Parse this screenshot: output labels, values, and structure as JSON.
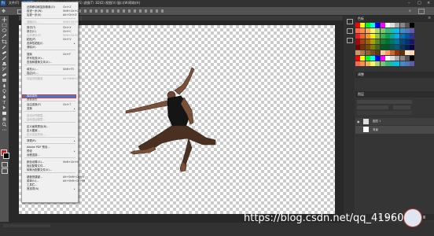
{
  "menubar": {
    "items": [
      "文件(F)",
      "编辑(E)",
      "图像(I)",
      "图层(L)",
      "文字(Y)",
      "选择(S)",
      "滤镜(T)",
      "3D(D)",
      "视图(V)",
      "窗口(W)",
      "帮助(H)"
    ]
  },
  "edit_menu": {
    "items": [
      {
        "label": "还原移动和复制像素(O)",
        "shortcut": "Ctrl+Z",
        "enabled": true
      },
      {
        "label": "前进一步(W)",
        "shortcut": "Shift+Ctrl+Z",
        "enabled": true
      },
      {
        "label": "后退一步(K)",
        "shortcut": "Alt+Ctrl+Z",
        "enabled": true
      },
      {
        "label": "渐隐(D)...",
        "shortcut": "Shift+Ctrl+F",
        "enabled": false
      },
      {
        "label": "剪切(T)",
        "shortcut": "Ctrl+X",
        "enabled": true
      },
      {
        "label": "拷贝(C)",
        "shortcut": "Ctrl+C",
        "enabled": true
      },
      {
        "label": "合并拷贝(Y)",
        "shortcut": "Shift+Ctrl+C",
        "enabled": false
      },
      {
        "label": "粘贴(P)",
        "shortcut": "Ctrl+V",
        "enabled": true
      },
      {
        "label": "选择性粘贴(I)",
        "shortcut": "",
        "enabled": true,
        "submenu": true
      },
      {
        "label": "清除(E)",
        "shortcut": "",
        "enabled": true
      },
      {
        "label": "搜索",
        "shortcut": "Ctrl+F",
        "enabled": true
      },
      {
        "label": "拼写检查(H)...",
        "shortcut": "",
        "enabled": true
      },
      {
        "label": "查找和替换文本(X)...",
        "shortcut": "",
        "enabled": true
      },
      {
        "label": "填充(L)...",
        "shortcut": "Shift+F5",
        "enabled": true
      },
      {
        "label": "描边(S)...",
        "shortcut": "",
        "enabled": true
      },
      {
        "label": "内容识别缩放",
        "shortcut": "Alt+Shift+Ctrl+C",
        "enabled": false
      },
      {
        "label": "操控变形",
        "shortcut": "",
        "enabled": true,
        "highlighted": true
      },
      {
        "label": "透视变形",
        "shortcut": "",
        "enabled": true
      },
      {
        "label": "自由变换(F)",
        "shortcut": "Ctrl+T",
        "enabled": true
      },
      {
        "label": "变换",
        "shortcut": "",
        "enabled": true,
        "submenu": true
      },
      {
        "label": "自动对齐图层...",
        "shortcut": "",
        "enabled": false
      },
      {
        "label": "自动混合图层...",
        "shortcut": "",
        "enabled": false
      },
      {
        "label": "定义画笔预设(B)...",
        "shortcut": "",
        "enabled": true
      },
      {
        "label": "定义图案...",
        "shortcut": "",
        "enabled": true
      },
      {
        "label": "定义自定形状...",
        "shortcut": "",
        "enabled": false
      },
      {
        "label": "清理(R)",
        "shortcut": "",
        "enabled": true,
        "submenu": true
      },
      {
        "label": "Adobe PDF 预设...",
        "shortcut": "",
        "enabled": true
      },
      {
        "label": "预设",
        "shortcut": "",
        "enabled": true,
        "submenu": true
      },
      {
        "label": "远程连接...",
        "shortcut": "",
        "enabled": true
      },
      {
        "label": "颜色设置(G)...",
        "shortcut": "Shift+Ctrl+K",
        "enabled": true
      },
      {
        "label": "指定配置文件...",
        "shortcut": "",
        "enabled": true
      },
      {
        "label": "转换为配置文件(V)...",
        "shortcut": "",
        "enabled": true
      },
      {
        "label": "键盘快捷键...",
        "shortcut": "Alt+Shift+Ctrl+K",
        "enabled": true
      },
      {
        "label": "菜单(U)...",
        "shortcut": "Alt+Shift+Ctrl+M",
        "enabled": true
      },
      {
        "label": "工具栏...",
        "shortcut": "",
        "enabled": true
      },
      {
        "label": "首选项(N)",
        "shortcut": "",
        "enabled": true,
        "submenu": true
      }
    ]
  },
  "panels": {
    "swatches_tab": "色板",
    "adjustments_tab": "调整",
    "layers_tab": "图层",
    "layer_names": [
      "图层 1",
      "背景"
    ]
  },
  "watermark": "https://blog.csdn.net/qq_41960",
  "colors": {
    "menubar_bg": "#323232",
    "highlight": "#3d7bd5",
    "highlight_border": "#e03030",
    "foreground_swatch": "#d21c1c"
  }
}
